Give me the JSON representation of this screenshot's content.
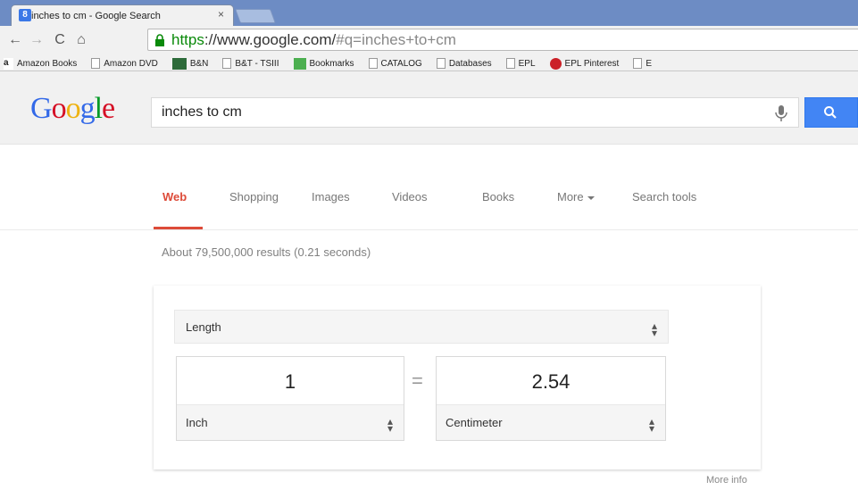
{
  "browser": {
    "tab_title": "inches to cm - Google Search",
    "tab_close": "×",
    "url_scheme": "https",
    "url_host": "://www.google.com/",
    "url_rest": "#q=inches+to+cm",
    "bookmarks": [
      {
        "label": "Amazon Books",
        "icon": "amazon-icon"
      },
      {
        "label": "Amazon DVD",
        "icon": "page-icon"
      },
      {
        "label": "B&N",
        "icon": "bn-icon"
      },
      {
        "label": "B&T - TSIII",
        "icon": "page-icon"
      },
      {
        "label": "Bookmarks",
        "icon": "bookmarks-icon"
      },
      {
        "label": "CATALOG",
        "icon": "page-icon"
      },
      {
        "label": "Databases",
        "icon": "page-icon"
      },
      {
        "label": "EPL",
        "icon": "page-icon"
      },
      {
        "label": "EPL Pinterest",
        "icon": "pinterest-icon"
      },
      {
        "label": "E",
        "icon": "page-icon"
      }
    ]
  },
  "google": {
    "logo": [
      "G",
      "o",
      "o",
      "g",
      "l",
      "e"
    ],
    "query": "inches to cm",
    "tabs": [
      "Web",
      "Shopping",
      "Images",
      "Videos",
      "Books",
      "More",
      "Search tools"
    ],
    "stats": "About 79,500,000 results (0.21 seconds)"
  },
  "converter": {
    "category": "Length",
    "from_value": "1",
    "from_unit": "Inch",
    "equals": "=",
    "to_value": "2.54",
    "to_unit": "Centimeter",
    "more_info": "More info"
  },
  "colors": {
    "accent_red": "#dd4b39",
    "search_blue": "#4285f4",
    "chrome_blue": "#6d8cc4"
  }
}
